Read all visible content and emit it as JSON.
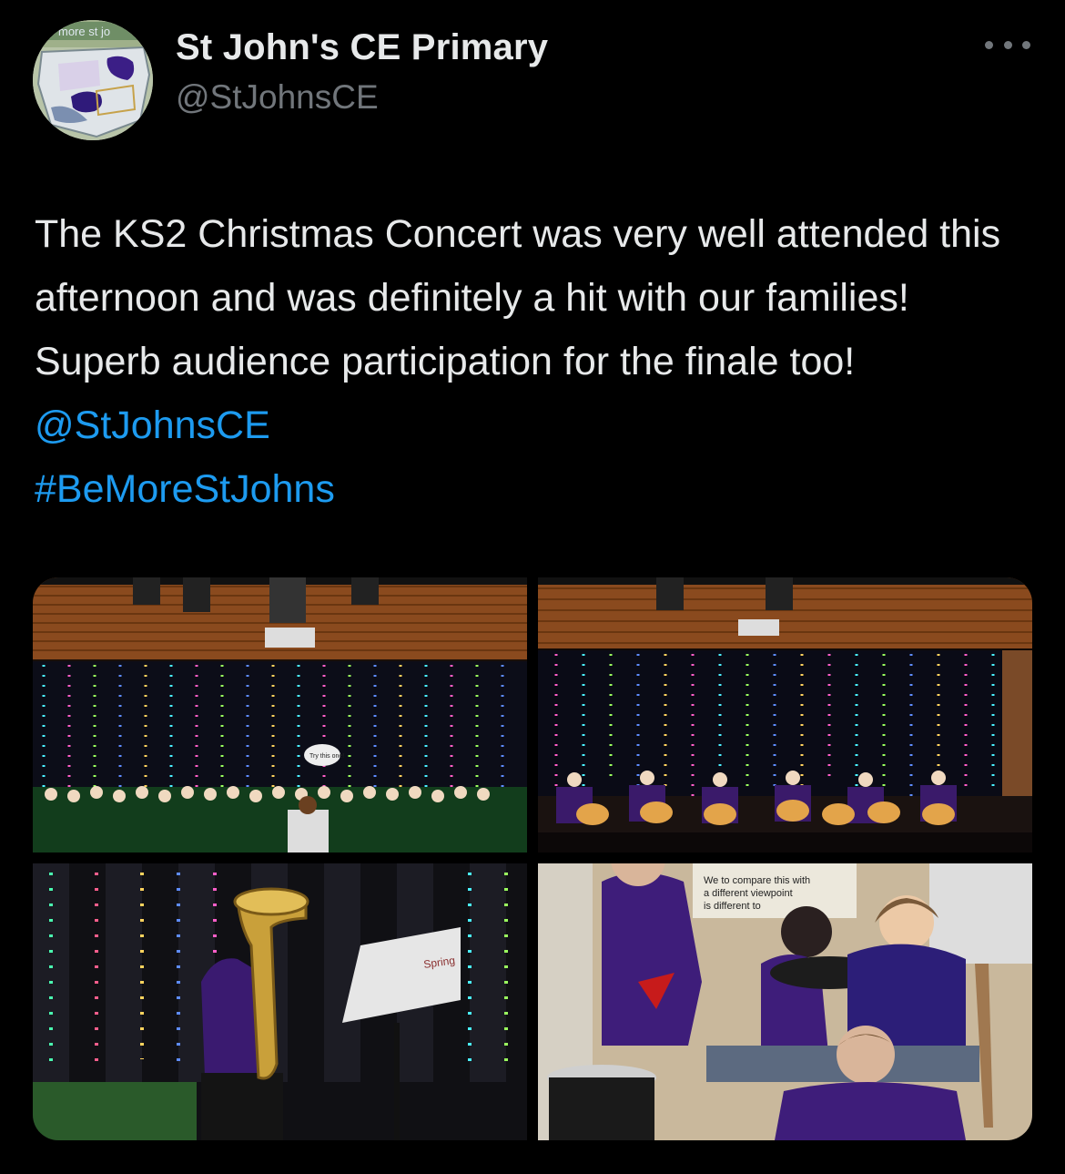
{
  "author": {
    "name": "St John's CE Primary",
    "handle": "@StJohnsCE",
    "avatar_text": "more st jo"
  },
  "tweet": {
    "text": "The KS2 Christmas Concert was very well attended this afternoon and was definitely a hit with our families! Superb audience participation for the finale too!",
    "mention": "@StJohnsCE",
    "hashtag": "#BeMoreStJohns"
  },
  "media": {
    "poster_text": "Try this one!",
    "sheet_label": "Spring",
    "whiteboard_text": [
      "We to compare this with",
      "a different viewpoint",
      "is different to"
    ]
  },
  "icons": {
    "more": "more-horizontal-icon"
  },
  "colors": {
    "background": "#000000",
    "text": "#e7e9ea",
    "secondary": "#71767b",
    "link": "#1d9bf0"
  }
}
